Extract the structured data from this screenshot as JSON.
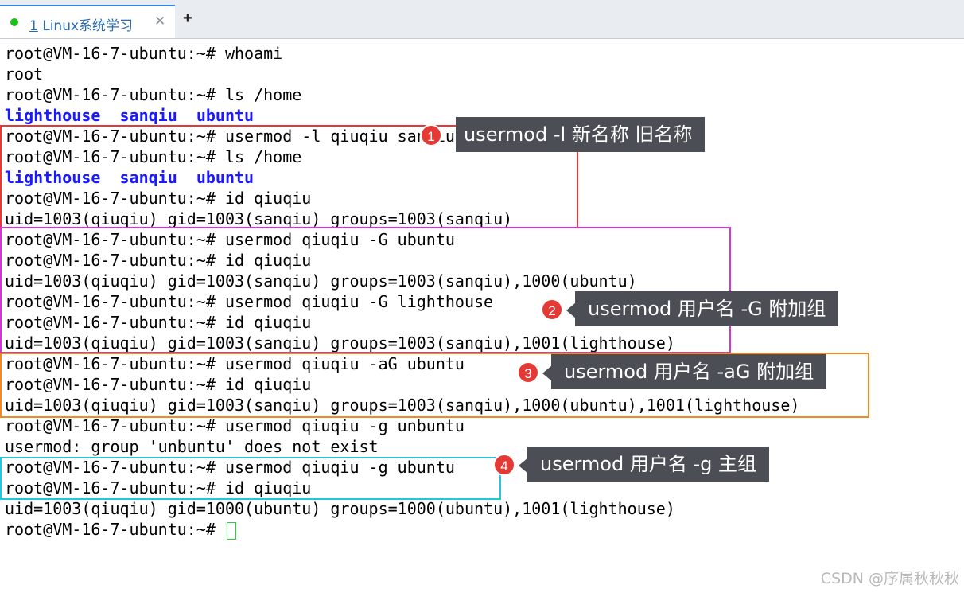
{
  "tab": {
    "number": "1",
    "title": "Linux系统学习",
    "close": "✕",
    "add": "+"
  },
  "terminal_lines": [
    "root@VM-16-7-ubuntu:~# whoami",
    "root",
    "root@VM-16-7-ubuntu:~# ls /home",
    "lighthouse  sanqiu  ubuntu",
    "root@VM-16-7-ubuntu:~# usermod -l qiuqiu sanqiu",
    "root@VM-16-7-ubuntu:~# ls /home",
    "lighthouse  sanqiu  ubuntu",
    "root@VM-16-7-ubuntu:~# id qiuqiu",
    "uid=1003(qiuqiu) gid=1003(sanqiu) groups=1003(sanqiu)",
    "root@VM-16-7-ubuntu:~# usermod qiuqiu -G ubuntu",
    "root@VM-16-7-ubuntu:~# id qiuqiu",
    "uid=1003(qiuqiu) gid=1003(sanqiu) groups=1003(sanqiu),1000(ubuntu)",
    "root@VM-16-7-ubuntu:~# usermod qiuqiu -G lighthouse",
    "root@VM-16-7-ubuntu:~# id qiuqiu",
    "uid=1003(qiuqiu) gid=1003(sanqiu) groups=1003(sanqiu),1001(lighthouse)",
    "root@VM-16-7-ubuntu:~# usermod qiuqiu -aG ubuntu",
    "root@VM-16-7-ubuntu:~# id qiuqiu",
    "uid=1003(qiuqiu) gid=1003(sanqiu) groups=1003(sanqiu),1000(ubuntu),1001(lighthouse)",
    "root@VM-16-7-ubuntu:~# usermod qiuqiu -g unbuntu",
    "usermod: group 'unbuntu' does not exist",
    "root@VM-16-7-ubuntu:~# usermod qiuqiu -g ubuntu",
    "root@VM-16-7-ubuntu:~# id qiuqiu",
    "uid=1003(qiuqiu) gid=1000(ubuntu) groups=1000(ubuntu),1001(lighthouse)",
    "root@VM-16-7-ubuntu:~# "
  ],
  "annotations": [
    {
      "badge": "1",
      "text": "usermod -l 新名称 旧名称",
      "color": "#e53935"
    },
    {
      "badge": "2",
      "text": "usermod 用户名 -G 附加组",
      "color": "#d633d6"
    },
    {
      "badge": "3",
      "text": "usermod 用户名 -aG 附加组",
      "color": "#f08a24"
    },
    {
      "badge": "4",
      "text": "usermod 用户名 -g 主组",
      "color": "#26c6da"
    }
  ],
  "colors": {
    "directory": "#1a1aff",
    "cursor": "#2ecc40",
    "callout_bg": "#4b4f55",
    "tab_accent": "#2e86de"
  },
  "watermark": "CSDN @序属秋秋秋"
}
